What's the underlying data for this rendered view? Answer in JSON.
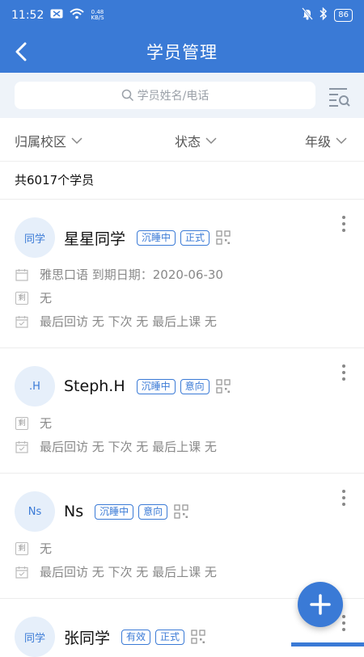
{
  "status_bar": {
    "time": "11:52",
    "net_speed_value": "0.48",
    "net_speed_unit": "KB/S",
    "battery": "86"
  },
  "nav": {
    "title": "学员管理"
  },
  "search": {
    "placeholder": "学员姓名/电话"
  },
  "filters": [
    {
      "label": "归属校区"
    },
    {
      "label": "状态"
    },
    {
      "label": "年级"
    }
  ],
  "summary": {
    "count_text": "共6017个学员"
  },
  "students": [
    {
      "avatar": "同学",
      "name": "星星同学",
      "tags": [
        "沉睡中",
        "正式"
      ],
      "course": "雅思口语 到期日期：2020-06-30",
      "remaining_icon": "剩",
      "remaining": "无",
      "visits": "最后回访 无 下次 无 最后上课 无"
    },
    {
      "avatar": ".H",
      "name": "Steph.H",
      "tags": [
        "沉睡中",
        "意向"
      ],
      "remaining_icon": "剩",
      "remaining": "无",
      "visits": "最后回访 无 下次 无 最后上课 无"
    },
    {
      "avatar": "Ns",
      "name": "Ns",
      "tags": [
        "沉睡中",
        "意向"
      ],
      "remaining_icon": "剩",
      "remaining": "无",
      "visits": "最后回访 无 下次 无 最后上课 无"
    },
    {
      "avatar": "同学",
      "name": "张同学",
      "tags": [
        "有效",
        "正式"
      ]
    }
  ],
  "colors": {
    "primary": "#3a7ad6",
    "search_bg": "#eef3f9",
    "muted_text": "#888888"
  }
}
